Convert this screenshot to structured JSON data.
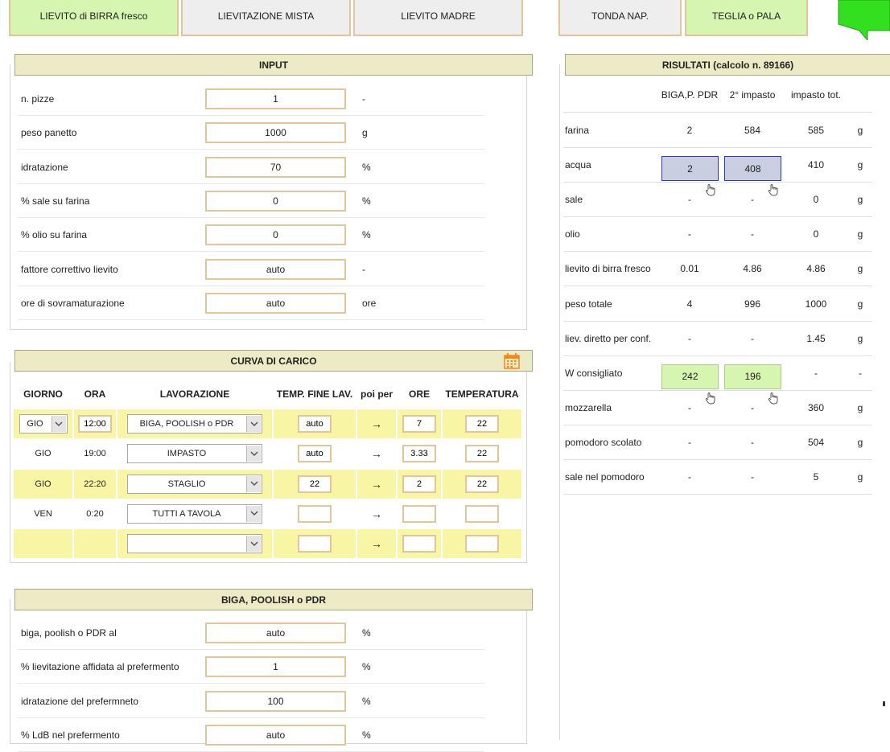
{
  "tabs": [
    {
      "label": "LIEVITO di BIRRA fresco",
      "state": "selected"
    },
    {
      "label": "LIEVITAZIONE MISTA",
      "state": "normal"
    },
    {
      "label": "LIEVITO MADRE",
      "state": "normal"
    },
    {
      "label": "TONDA NAP.",
      "state": "normal"
    },
    {
      "label": "TEGLIA o PALA",
      "state": "selected"
    }
  ],
  "input": {
    "title": "INPUT",
    "rows": [
      {
        "label": "n. pizze",
        "value": "1",
        "unit": "-"
      },
      {
        "label": "peso panetto",
        "value": "1000",
        "unit": "g"
      },
      {
        "label": "idratazione",
        "value": "70",
        "unit": "%"
      },
      {
        "label": "% sale su farina",
        "value": "0",
        "unit": "%"
      },
      {
        "label": "% olio su farina",
        "value": "0",
        "unit": "%"
      },
      {
        "label": "fattore correttivo lievito",
        "value": "auto",
        "unit": "-"
      },
      {
        "label": "ore di sovramaturazione",
        "value": "auto",
        "unit": "ore"
      }
    ]
  },
  "curve": {
    "title": "CURVA DI CARICO",
    "headers": {
      "giorno": "GIORNO",
      "ora": "ORA",
      "lavorazione": "LAVORAZIONE",
      "temp_fine": "TEMP. FINE LAV.",
      "poi_per": "poi per",
      "ore": "ORE",
      "temperatura": "TEMPERATURA"
    },
    "arrow": "→",
    "rows": [
      {
        "giorno": "GIO",
        "ora": "12:00",
        "lavorazione": "BIGA, POOLISH o PDR",
        "temp_fine": "auto",
        "ore": "7",
        "temperatura": "22"
      },
      {
        "giorno": "GIO",
        "ora": "19:00",
        "lavorazione": "IMPASTO",
        "temp_fine": "auto",
        "ore": "3.33",
        "temperatura": "22"
      },
      {
        "giorno": "GIO",
        "ora": "22:20",
        "lavorazione": "STAGLIO",
        "temp_fine": "22",
        "ore": "2",
        "temperatura": "22"
      },
      {
        "giorno": "VEN",
        "ora": "0:20",
        "lavorazione": "TUTTI A TAVOLA",
        "temp_fine": "",
        "ore": "",
        "temperatura": ""
      },
      {
        "giorno": "",
        "ora": "",
        "lavorazione": "",
        "temp_fine": "",
        "ore": "",
        "temperatura": ""
      }
    ]
  },
  "biga": {
    "title": "BIGA, POOLISH o PDR",
    "rows": [
      {
        "label": "biga, poolish o PDR al",
        "value": "auto",
        "unit": "%"
      },
      {
        "label": "% lievitazione affidata al prefermento",
        "value": "1",
        "unit": "%"
      },
      {
        "label": "idratazione del prefermneto",
        "value": "100",
        "unit": "%"
      },
      {
        "label": "% LdB nel prefermento",
        "value": "auto",
        "unit": "%"
      }
    ]
  },
  "results": {
    "title": "RISULTATI (calcolo n. 89166)",
    "columns": [
      "BIGA,P. PDR",
      "2° impasto",
      "impasto tot."
    ],
    "rows": [
      {
        "label": "farina",
        "v1": "2",
        "v2": "584",
        "v3": "585",
        "unit": "g"
      },
      {
        "label": "acqua",
        "v1": "2",
        "v2": "408",
        "v3": "410",
        "unit": "g"
      },
      {
        "label": "sale",
        "v1": "-",
        "v2": "-",
        "v3": "0",
        "unit": "g"
      },
      {
        "label": "olio",
        "v1": "-",
        "v2": "-",
        "v3": "0",
        "unit": "g"
      },
      {
        "label": "lievito di birra fresco",
        "v1": "0.01",
        "v2": "4.86",
        "v3": "4.86",
        "unit": "g"
      },
      {
        "label": "peso totale",
        "v1": "4",
        "v2": "996",
        "v3": "1000",
        "unit": "g"
      },
      {
        "label": "liev. diretto per conf.",
        "v1": "-",
        "v2": "-",
        "v3": "1.45",
        "unit": "g"
      },
      {
        "label": "W consigliato",
        "v1": "242",
        "v2": "196",
        "v3": "-",
        "unit": "-"
      },
      {
        "label": "mozzarella",
        "v1": "-",
        "v2": "-",
        "v3": "360",
        "unit": "g"
      },
      {
        "label": "pomodoro scolato",
        "v1": "-",
        "v2": "-",
        "v3": "504",
        "unit": "g"
      },
      {
        "label": "sale nel pomodoro",
        "v1": "-",
        "v2": "-",
        "v3": "5",
        "unit": "g"
      }
    ]
  },
  "icons": {
    "calendar": "calendar-icon",
    "dropdown": "chevron-down-icon",
    "hand": "hand-pointer-icon"
  },
  "colors": {
    "tab_green": "#d6f5b0",
    "tab_gray": "#eeeeee",
    "header_bg": "#ecebc5",
    "row_yellow": "#f8f6a4",
    "box_blue": "#c9cfe0",
    "input_border": "#e3c59a"
  }
}
